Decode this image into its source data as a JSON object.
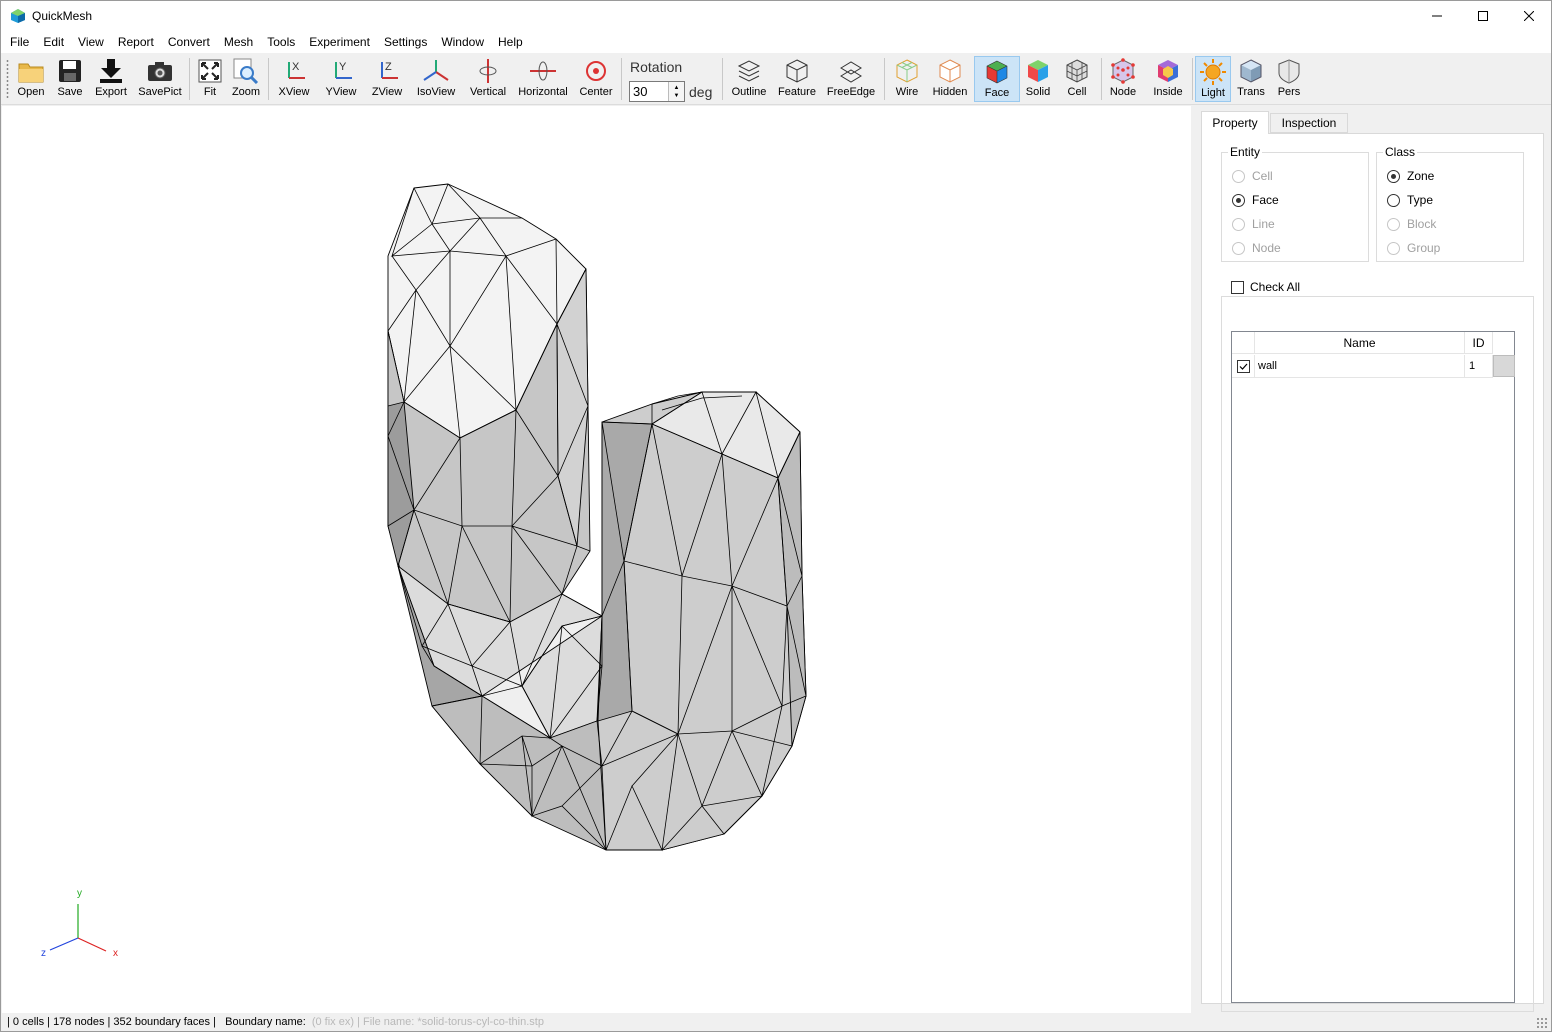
{
  "window": {
    "title": "QuickMesh"
  },
  "menu": [
    "File",
    "Edit",
    "View",
    "Report",
    "Convert",
    "Mesh",
    "Tools",
    "Experiment",
    "Settings",
    "Window",
    "Help"
  ],
  "toolbar": {
    "open": "Open",
    "save": "Save",
    "export": "Export",
    "savepict": "SavePict",
    "fit": "Fit",
    "zoom": "Zoom",
    "xview": "XView",
    "yview": "YView",
    "zview": "ZView",
    "isoview": "IsoView",
    "vertical": "Vertical",
    "horizontal": "Horizontal",
    "center": "Center",
    "rotation_label": "Rotation",
    "rotation_value": "30",
    "rotation_unit": "deg",
    "outline": "Outline",
    "feature": "Feature",
    "freeedge": "FreeEdge",
    "wire": "Wire",
    "hidden": "Hidden",
    "face": "Face",
    "solid": "Solid",
    "cell": "Cell",
    "node": "Node",
    "inside": "Inside",
    "light": "Light",
    "trans": "Trans",
    "pers": "Pers"
  },
  "axes": {
    "x": "x",
    "y": "y",
    "z": "z"
  },
  "panel": {
    "tabs": [
      "Property",
      "Inspection"
    ],
    "entity": {
      "title": "Entity",
      "options": [
        "Cell",
        "Face",
        "Line",
        "Node"
      ],
      "selected": "Face"
    },
    "class": {
      "title": "Class",
      "options": [
        "Zone",
        "Type",
        "Block",
        "Group"
      ],
      "selected": "Zone"
    },
    "check_all": "Check All",
    "table": {
      "headers": [
        "Name",
        "ID"
      ],
      "rows": [
        {
          "checked": true,
          "name": "wall",
          "id": "1"
        }
      ]
    }
  },
  "status": {
    "main": "| 0 cells | 178 nodes | 352 boundary faces |   Boundary name:",
    "faded": "(0 fix ex) | File name: *solid-torus-cyl-co-thin.stp"
  },
  "colors": {
    "accent": "#0078d7",
    "toolbar_active": "#cce4f7",
    "mesh_fill": "#c8c8c8"
  }
}
